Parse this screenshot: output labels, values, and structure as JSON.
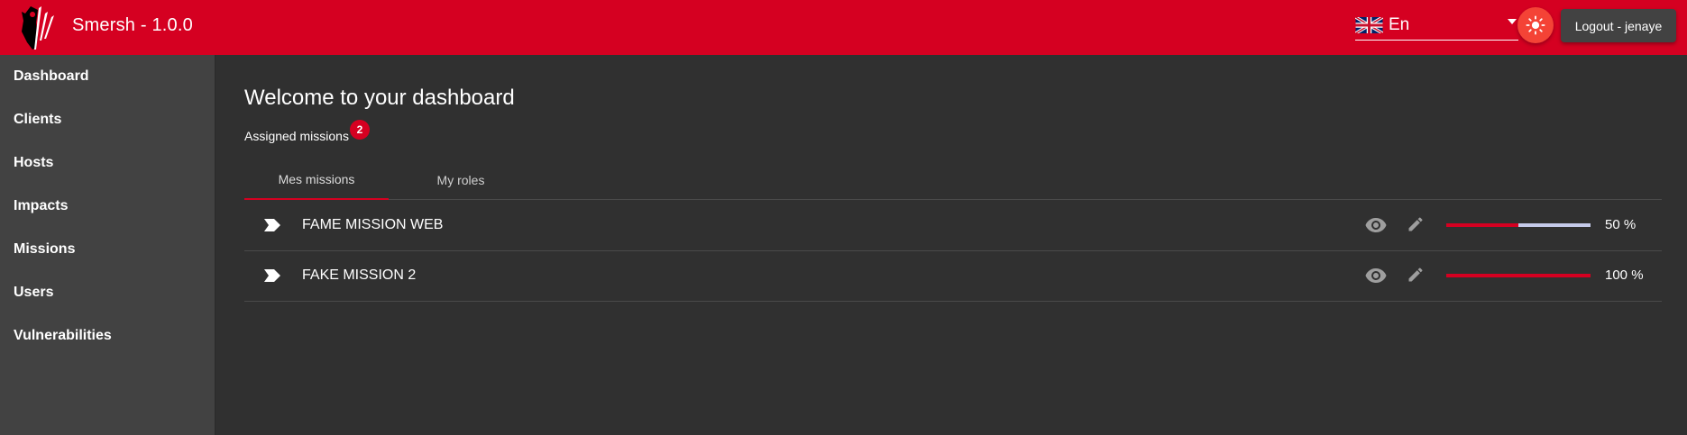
{
  "header": {
    "app_title": "Smersh - 1.0.0",
    "language": {
      "label": "En",
      "flag": "uk-flag-icon"
    },
    "theme_toggle_icon": "sun-icon",
    "logout_label": "Logout - jenaye",
    "brand_color": "#d50021"
  },
  "sidebar": {
    "items": [
      {
        "label": "Dashboard"
      },
      {
        "label": "Clients"
      },
      {
        "label": "Hosts"
      },
      {
        "label": "Impacts"
      },
      {
        "label": "Missions"
      },
      {
        "label": "Users"
      },
      {
        "label": "Vulnerabilities"
      }
    ]
  },
  "main": {
    "title": "Welcome to your dashboard",
    "assigned_label": "Assigned missions",
    "assigned_count": "2",
    "tabs": [
      {
        "label": "Mes missions",
        "active": true
      },
      {
        "label": "My roles",
        "active": false
      }
    ],
    "missions": [
      {
        "name": "FAME MISSION WEB",
        "progress": 50,
        "progress_label": "50 %"
      },
      {
        "name": "FAKE MISSION 2",
        "progress": 100,
        "progress_label": "100 %"
      }
    ]
  }
}
